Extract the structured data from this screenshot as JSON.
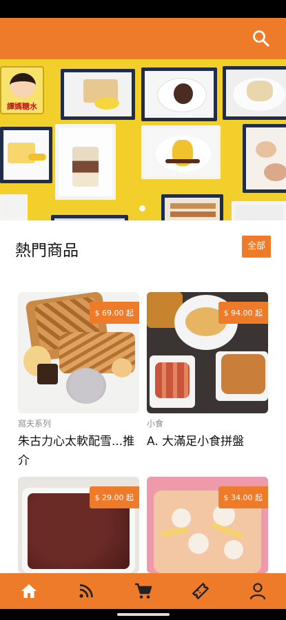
{
  "colors": {
    "accent": "#EE7B2A",
    "banner_bg": "#F2CF2A"
  },
  "app_bar": {
    "search_icon": "search-icon"
  },
  "banner": {
    "shop_sign_text": "譚媽糖水",
    "indicator_count": 1
  },
  "section": {
    "title": "熱門商品",
    "all_button_label": "全部"
  },
  "products": [
    {
      "price": "$ 69.00 起",
      "category": "窩夫系列",
      "name": "朱古力心太軟配雪...推介"
    },
    {
      "price": "$ 94.00 起",
      "category": "小食",
      "name": "A. 大滿足小食拼盤"
    },
    {
      "price": "$ 29.00 起",
      "category": "",
      "name": ""
    },
    {
      "price": "$ 34.00 起",
      "category": "",
      "name": ""
    }
  ],
  "bottom_nav": [
    {
      "icon": "home-icon",
      "active": true
    },
    {
      "icon": "rss-feed-icon",
      "active": false
    },
    {
      "icon": "shopping-cart-icon",
      "active": false
    },
    {
      "icon": "ticket-icon",
      "active": false
    },
    {
      "icon": "person-icon",
      "active": false
    }
  ]
}
